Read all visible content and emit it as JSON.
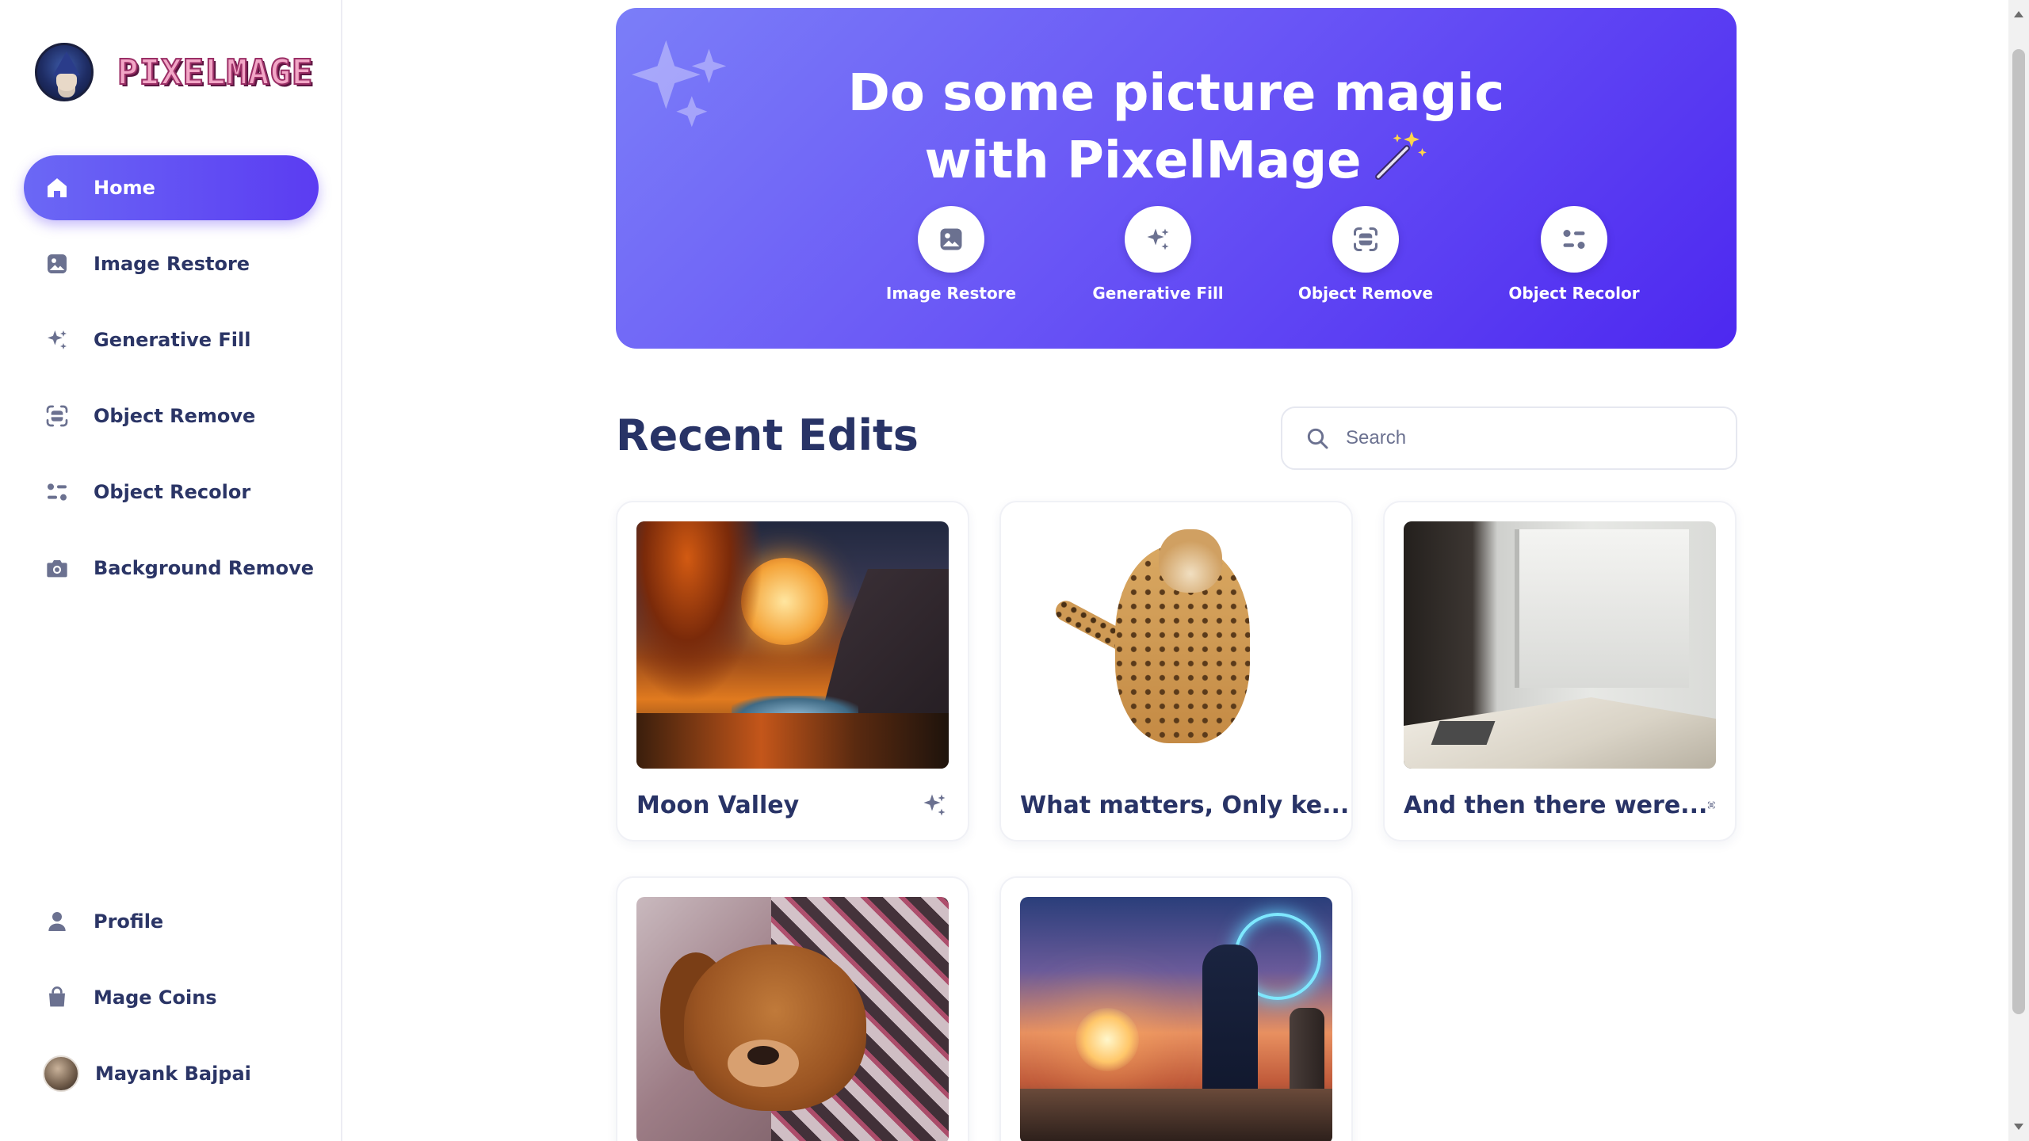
{
  "brand": {
    "name": "PIXELMAGE",
    "logo_icon": "wizard-avatar"
  },
  "sidebar": {
    "items": [
      {
        "label": "Home",
        "icon": "home-icon",
        "active": true
      },
      {
        "label": "Image Restore",
        "icon": "image-icon"
      },
      {
        "label": "Generative Fill",
        "icon": "sparkles-icon"
      },
      {
        "label": "Object Remove",
        "icon": "scan-icon"
      },
      {
        "label": "Object Recolor",
        "icon": "sliders-icon"
      },
      {
        "label": "Background Remove",
        "icon": "camera-icon"
      }
    ],
    "bottom_items": [
      {
        "label": "Profile",
        "icon": "user-icon"
      },
      {
        "label": "Mage Coins",
        "icon": "bag-icon"
      }
    ],
    "user": {
      "name": "Mayank Bajpai"
    }
  },
  "hero": {
    "title_line1": "Do some picture magic",
    "title_line2": "with PixelMage",
    "actions": [
      {
        "label": "Image Restore",
        "icon": "image-icon"
      },
      {
        "label": "Generative Fill",
        "icon": "sparkles-icon"
      },
      {
        "label": "Object Remove",
        "icon": "scan-icon"
      },
      {
        "label": "Object Recolor",
        "icon": "sliders-icon"
      }
    ]
  },
  "recent": {
    "title": "Recent Edits",
    "search_placeholder": "Search",
    "cards": [
      {
        "title": "Moon Valley",
        "icon": "sparkles-icon"
      },
      {
        "title": "What matters, Only ke...",
        "icon": "camera-icon"
      },
      {
        "title": "And then there were...",
        "icon": "scan-icon"
      },
      {
        "title": "",
        "icon": ""
      },
      {
        "title": "",
        "icon": ""
      }
    ]
  },
  "colors": {
    "accent": "#5b3cf2",
    "accent_light": "#7b7ef8",
    "text": "#283366",
    "icon": "#6b7190"
  }
}
